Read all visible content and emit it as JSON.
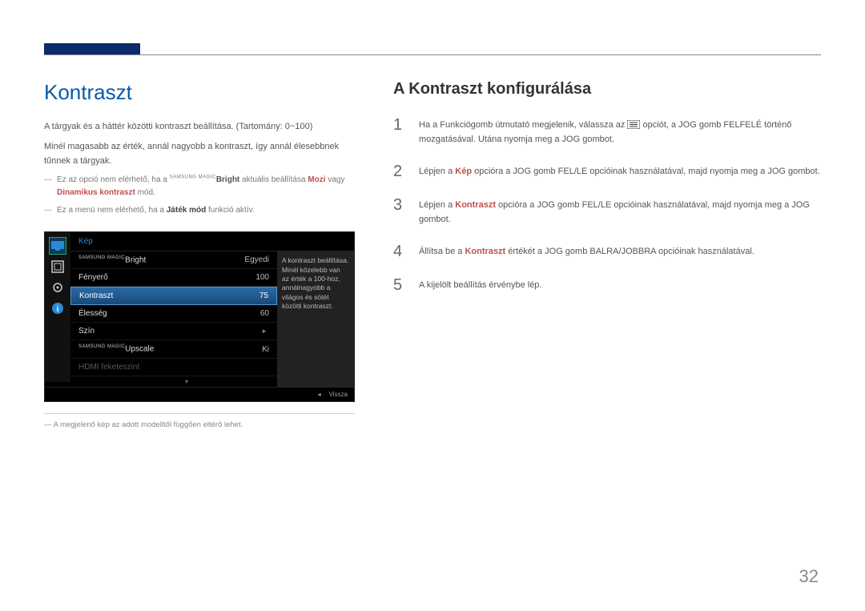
{
  "left": {
    "title": "Kontraszt",
    "p1": "A tárgyak és a háttér közötti kontraszt beállítása. (Tartomány: 0~100)",
    "p2": "Minél magasabb az érték, annál nagyobb a kontraszt, így annál élesebbnek tűnnek a tárgyak.",
    "note1_pre": "Ez az opció nem elérhető, ha a ",
    "note1_magic_prefix": "SAMSUNG MAGIC",
    "note1_bright": "Bright",
    "note1_mid": " aktuális beállítása ",
    "note1_mozi": "Mozi",
    "note1_or": " vagy ",
    "note1_dk": "Dinamikus kontraszt",
    "note1_end": " mód.",
    "note2_pre": "Ez a menü nem elérhető, ha a ",
    "note2_bold": "Játék mód",
    "note2_end": " funkció aktív.",
    "footnote": "A megjelenő kép az adott modelltől függően eltérő lehet."
  },
  "osd": {
    "header": "Kép",
    "rows": {
      "magicbright": {
        "prefix": "SAMSUNG MAGIC",
        "label": "Bright",
        "value": "Egyedi"
      },
      "fenyero": {
        "label": "Fényerő",
        "value": "100"
      },
      "kontraszt": {
        "label": "Kontraszt",
        "value": "75"
      },
      "elesseg": {
        "label": "Élesség",
        "value": "60"
      },
      "szin": {
        "label": "Szín",
        "value": ""
      },
      "upscale": {
        "prefix": "SAMSUNG MAGIC",
        "label": "Upscale",
        "value": "Ki"
      },
      "hdmi": {
        "label": "HDMI feketeszint",
        "value": ""
      }
    },
    "desc": "A kontraszt beállítása. Minél közelebb van az érték a 100-hoz, annálnagyobb a világos és sötét közötti kontraszt.",
    "footer_back": "Vissza"
  },
  "right": {
    "title": "A Kontraszt konfigurálása",
    "steps": {
      "s1a": "Ha a Funkciógomb útmutató megjelenik, válassza az ",
      "s1b": " opciót, a JOG gomb FELFELÉ történő mozgatásával. Utána nyomja meg a JOG gombot.",
      "s2a": "Lépjen a ",
      "s2_kw": "Kép",
      "s2b": " opcióra a JOG gomb FEL/LE opcióinak használatával, majd nyomja meg a JOG gombot.",
      "s3a": "Lépjen a ",
      "s3_kw": "Kontraszt",
      "s3b": " opcióra a JOG gomb FEL/LE opcióinak használatával, majd nyomja meg a JOG gombot.",
      "s4a": "Állítsa be a ",
      "s4_kw": "Kontraszt",
      "s4b": " értékét a JOG gomb BALRA/JOBBRA opcióinak használatával.",
      "s5": "A kijelölt beállítás érvénybe lép."
    }
  },
  "page_number": "32"
}
